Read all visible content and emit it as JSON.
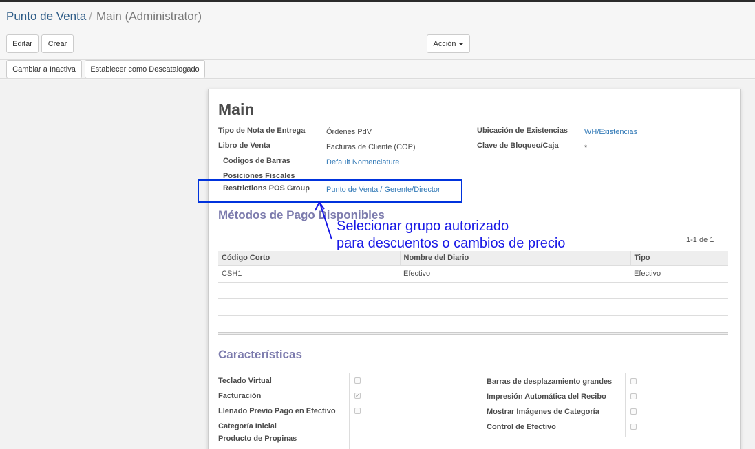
{
  "breadcrumb": {
    "parent": "Punto de Venta",
    "separator": "/",
    "current": "Main (Administrator)"
  },
  "toolbar": {
    "edit": "Editar",
    "create": "Crear",
    "action": "Acción"
  },
  "statusbar": {
    "deactivate": "Cambiar a Inactiva",
    "discontinue": "Establecer como Descatalogado"
  },
  "form": {
    "title": "Main",
    "left_fields": [
      {
        "label": "Tipo de Nota de Entrega",
        "value": "Órdenes PdV"
      },
      {
        "label": "Libro de Venta",
        "value": "Facturas de Cliente (COP)"
      },
      {
        "label": "Codigos de Barras",
        "value": "Default Nomenclature"
      },
      {
        "label": "Posiciones Fiscales",
        "value": ""
      },
      {
        "label": "Restrictions POS Group",
        "value": "Punto de Venta / Gerente/Director"
      }
    ],
    "right_fields": [
      {
        "label": "Ubicación de Existencias",
        "value": "WH/Existencias"
      },
      {
        "label": "Clave de Bloqueo/Caja",
        "value": "*"
      }
    ]
  },
  "annotation": {
    "line1": "Selecionar grupo autorizado",
    "line2": "para descuentos o cambios de precio"
  },
  "payment_methods": {
    "title": "Métodos de Pago Disponibles",
    "pager": "1-1 de 1",
    "headers": [
      "Código Corto",
      "Nombre del Diario",
      "Tipo"
    ],
    "rows": [
      [
        "CSH1",
        "Efectivo",
        "Efectivo"
      ]
    ]
  },
  "features": {
    "title": "Características",
    "left": [
      {
        "label": "Teclado Virtual",
        "checked": false
      },
      {
        "label": "Facturación",
        "checked": true
      },
      {
        "label": "Llenado Previo Pago en Efectivo",
        "checked": false
      },
      {
        "label": "Categoría Inicial"
      },
      {
        "label": "Producto de Propinas"
      }
    ],
    "right": [
      {
        "label": "Barras de desplazamiento grandes",
        "checked": false
      },
      {
        "label": "Impresión Automática del Recibo",
        "checked": false
      },
      {
        "label": "Mostrar Imágenes de Categoría",
        "checked": false
      },
      {
        "label": "Control de Efectivo",
        "checked": false
      }
    ]
  },
  "colors": {
    "link": "#337ab7",
    "section": "#7c7bad",
    "annotation": "#1a1ae6",
    "breadcrumb": "#2e5c87"
  }
}
